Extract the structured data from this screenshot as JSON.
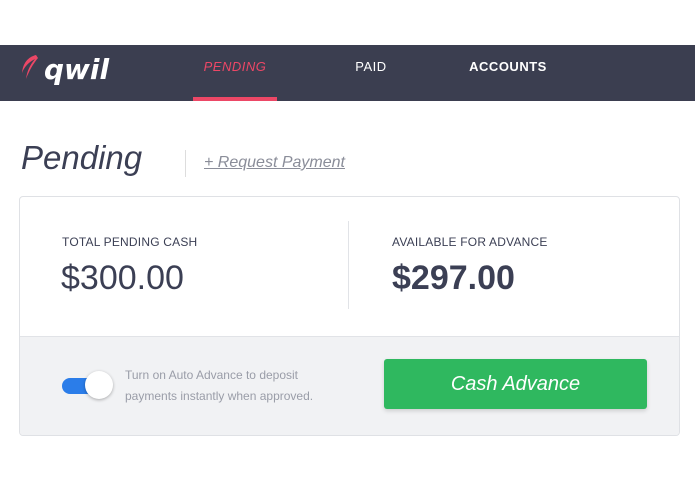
{
  "brand": {
    "name": "qwil",
    "accent_color": "#ec4766",
    "nav_bg": "#3b3e50"
  },
  "nav": {
    "items": [
      {
        "label": "PENDING",
        "active": true
      },
      {
        "label": "PAID",
        "active": false
      },
      {
        "label": "ACCOUNTS",
        "active": false
      }
    ]
  },
  "page": {
    "title": "Pending",
    "request_link": "+ Request Payment"
  },
  "summary": {
    "total_label": "TOTAL PENDING CASH",
    "total_value": "$300.00",
    "available_label": "AVAILABLE FOR ADVANCE",
    "available_value": "$297.00"
  },
  "auto_advance": {
    "enabled": true,
    "description": "Turn on Auto Advance to deposit payments instantly when approved."
  },
  "cash_advance": {
    "label": "Cash Advance",
    "color": "#2fb85f"
  }
}
